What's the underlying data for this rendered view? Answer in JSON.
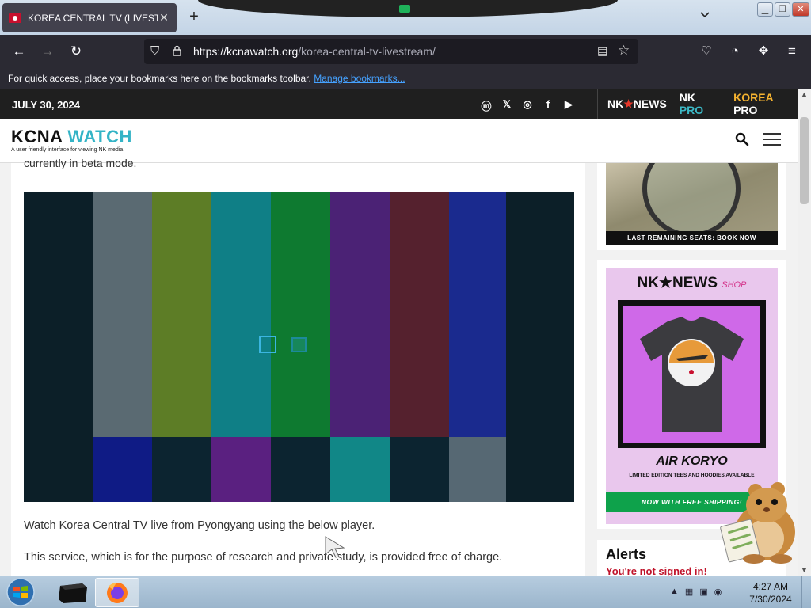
{
  "browser": {
    "tab_title": "KOREA CENTRAL TV (LIVESTREAM)",
    "tab_close": "✕",
    "new_tab": "+",
    "tabs_list": "⌄",
    "url_domain": "https://kcnawatch.org",
    "url_path": "/korea-central-tv-livestream/",
    "bookmarks_text": "For quick access, place your bookmarks here on the bookmarks toolbar.",
    "bookmarks_link": "Manage bookmarks..."
  },
  "page": {
    "date": "JULY 30, 2024",
    "brands": {
      "nk_news_a": "NK",
      "nk_news_star": "★",
      "nk_news_b": "NEWS",
      "nk_pro_a": "NK",
      "nk_pro_b": " PRO",
      "korea_pro_a": "KOREA",
      "korea_pro_b": " PRO"
    },
    "logo": {
      "name_a": "KCNA",
      "name_b": " WATCH",
      "tagline": "A user friendly interface for viewing NK media"
    },
    "beta_note": "currently in beta mode.",
    "paragraph_1": "Watch Korea Central TV live from Pyongyang using the below player.",
    "paragraph_2": "This service, which is for the purpose of research and private study, is provided free of charge."
  },
  "test_pattern": {
    "top_bars": [
      "#0c1f28",
      "#5a6a72",
      "#5d7d26",
      "#0f7f86",
      "#0e7a30",
      "#4b2275",
      "#55212e",
      "#1a2a8e",
      "#0c1f28"
    ],
    "bottom_bars": [
      "#0c1f28",
      "#0f1b85",
      "#0c2430",
      "#5a2080",
      "#0c2430",
      "#118787",
      "#0c2430",
      "#566873",
      "#0c1f28"
    ]
  },
  "sidebar": {
    "ad_banner": "LAST REMAINING SEATS: BOOK NOW",
    "shop_brand": "NK★NEWS",
    "shop_label": "SHOP",
    "shop_title": "AIR KORYO",
    "shop_subtitle": "LIMITED EDITION TEES AND HOODIES AVAILABLE",
    "shop_shipping": "NOW WITH FREE SHIPPING!",
    "alerts_title": "Alerts",
    "alerts_sub": "You're not signed in!"
  },
  "taskbar": {
    "time": "4:27 AM",
    "date": "7/30/2024"
  },
  "colors": {
    "accent_teal": "#33b3c6",
    "korea_pro": "#f5b330",
    "shop_green": "#0ea24b",
    "alert_red": "#c0142b"
  }
}
